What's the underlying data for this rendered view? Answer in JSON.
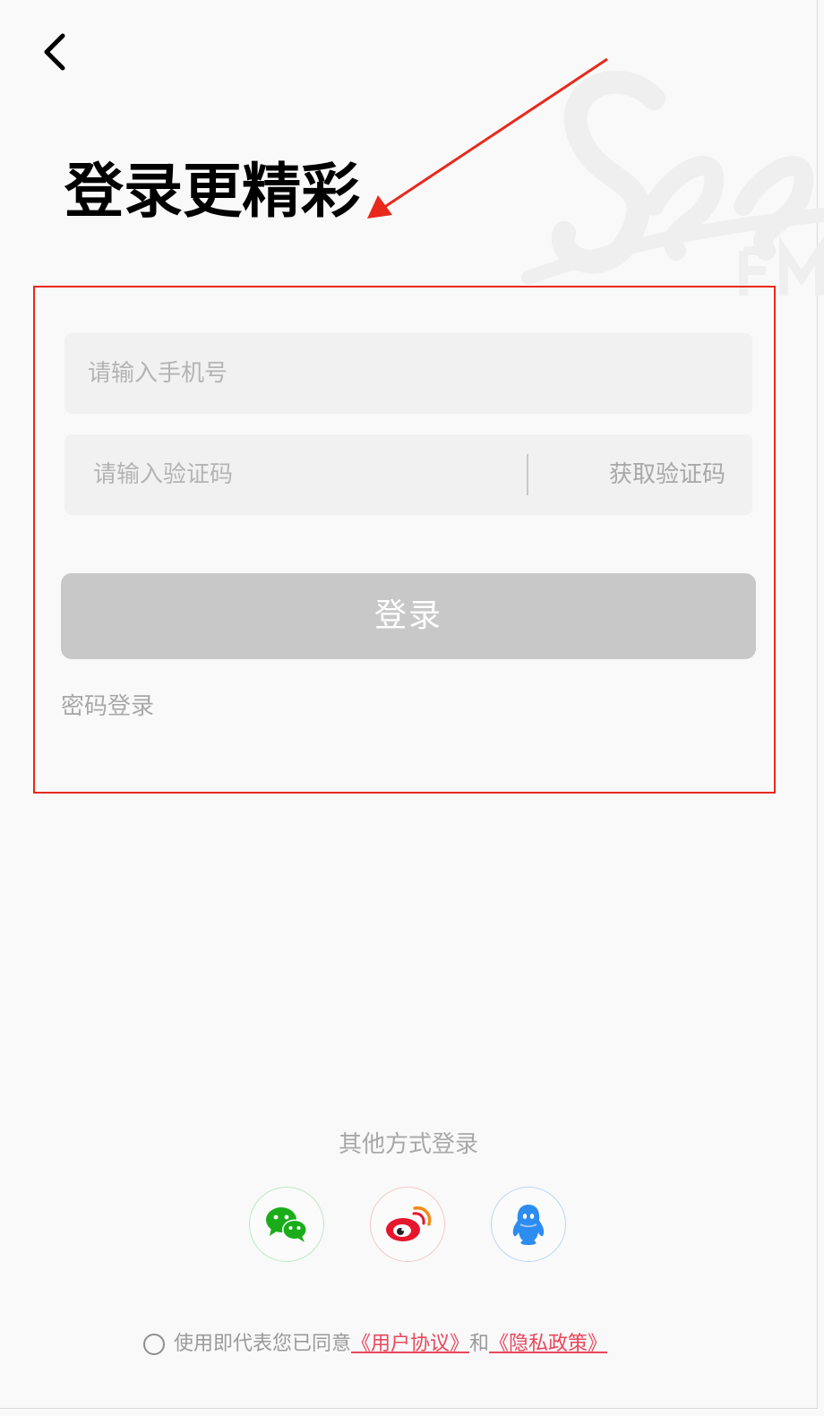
{
  "header": {
    "title": "登录更精彩"
  },
  "form": {
    "phone_placeholder": "请输入手机号",
    "code_placeholder": "请输入验证码",
    "get_code_label": "获取验证码",
    "login_label": "登录",
    "password_login_label": "密码登录"
  },
  "other_login": {
    "label": "其他方式登录",
    "providers": [
      {
        "name": "wechat",
        "icon": "wechat-icon",
        "color": "#1AAD19"
      },
      {
        "name": "weibo",
        "icon": "weibo-icon",
        "color": "#E6162D"
      },
      {
        "name": "qq",
        "icon": "qq-icon",
        "color": "#2D8CF0"
      }
    ]
  },
  "agreement": {
    "prefix": "使用即代表您已同意",
    "user_agreement": "《用户协议》",
    "conjunction": "和",
    "privacy_policy": "《隐私政策》"
  },
  "colors": {
    "annotation": "#E8291C",
    "button_disabled": "#C8C8C8",
    "link": "#E8475C",
    "input_bg": "#F1F1F1"
  }
}
